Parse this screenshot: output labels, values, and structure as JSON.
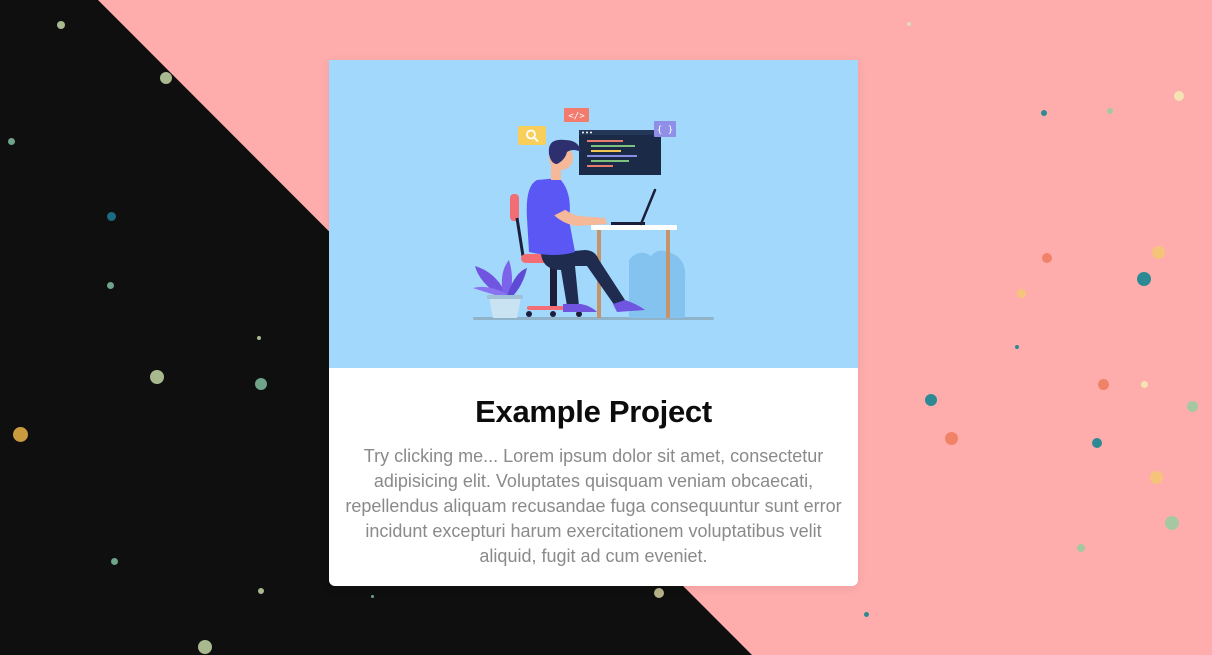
{
  "card": {
    "title": "Example Project",
    "description": "Try clicking me... Lorem ipsum dolor sit amet, consectetur adipisicing elit. Voluptates quisquam veniam obcaecati, repellendus aliquam recusandae fuga consequuntur sunt error incidunt excepturi harum exercitationem voluptatibus velit aliquid, fugit ad cum eveniet.",
    "illustration": {
      "code_tag": "</>",
      "braces_tag": "{ }",
      "search_icon": "search-icon"
    }
  },
  "colors": {
    "background_dark": "#0f0f0f",
    "background_pink": "#ffadac",
    "card_image_bg": "#a1d8fc",
    "card_bg": "#ffffff",
    "title": "#0c0c0c",
    "description": "#8a8a8a"
  }
}
